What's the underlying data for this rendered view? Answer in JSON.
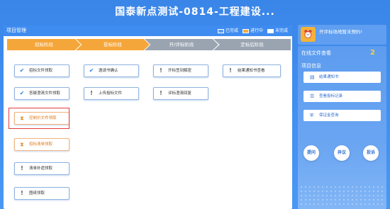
{
  "header": {
    "title": "国泰新点测试-0814-工程建设..."
  },
  "project_panel": {
    "title": "项目管理",
    "legend": {
      "done": "已完成",
      "doing": "进行中",
      "todo": "未完成"
    },
    "colors": {
      "done": "#5b9cf2",
      "doing": "#f7a93c",
      "todo": "#ffffff"
    },
    "steps": [
      "招标阶段",
      "投标阶段",
      "开/评标阶段",
      "定标后阶段"
    ]
  },
  "tasks": {
    "tender_doc_collect": "招标文件领取",
    "clarify_doc_collect": "答疑澄清文件领取",
    "control_price_collect": "控制价文件领取",
    "bill_collect": "招标清单领取",
    "bill_supplement_collect": "清单补遗领取",
    "drawing_collect": "图纸领取",
    "invitation_confirm": "邀请书确认",
    "upload_bid_doc": "上传投标文件",
    "open_bid_decrypt": "开标签到解密",
    "eval_clarify_reply": "评标澄清回复",
    "result_notice_view": "结果通知书查看"
  },
  "right": {
    "notice": "开评标场地暂未预约!",
    "online_title": "在线文件查看",
    "online_count": "2",
    "project_info_title": "项目信息",
    "result_notice": "结果通知书",
    "bid_record": "查看投标记录",
    "deposit_query": "保证金查询",
    "ask": "提问",
    "objection": "异议",
    "complaint": "投诉"
  }
}
